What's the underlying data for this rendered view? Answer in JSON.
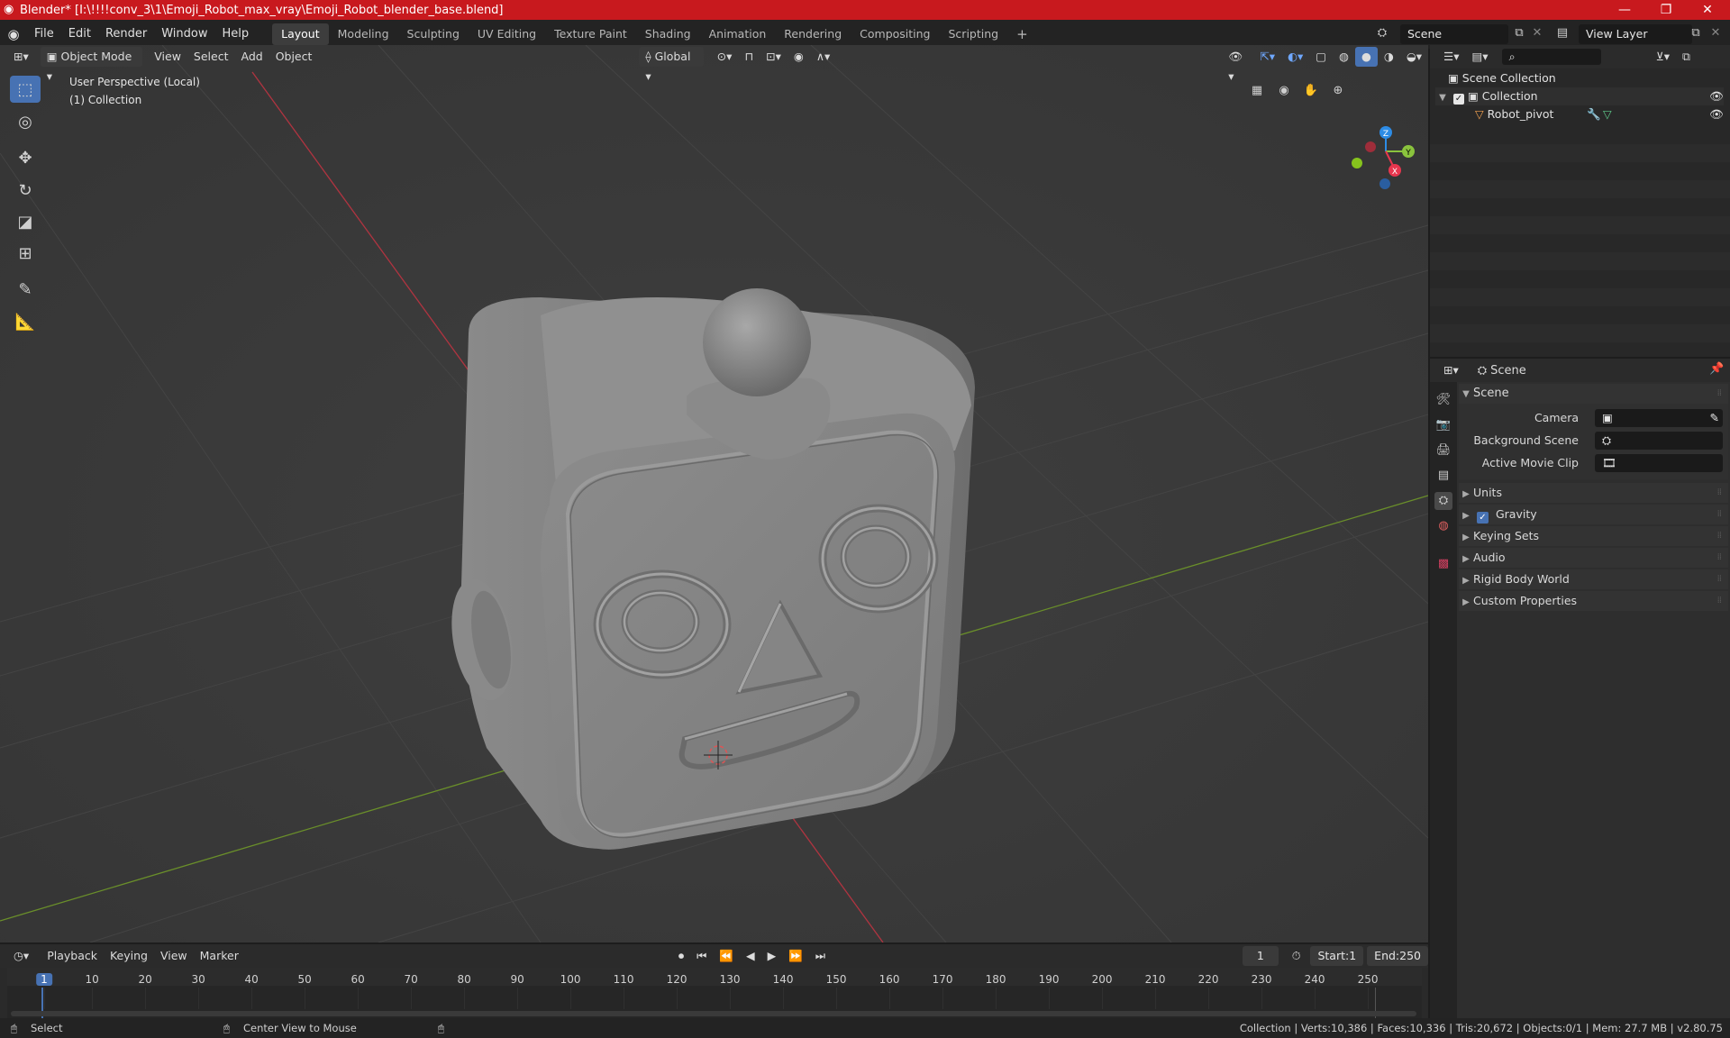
{
  "window": {
    "title": "Blender* [I:\\!!!!conv_3\\1\\Emoji_Robot_max_vray\\Emoji_Robot_blender_base.blend]",
    "minimize": "—",
    "maximize": "❐",
    "close": "✕"
  },
  "menu": [
    "File",
    "Edit",
    "Render",
    "Window",
    "Help"
  ],
  "workspaces": [
    "Layout",
    "Modeling",
    "Sculpting",
    "UV Editing",
    "Texture Paint",
    "Shading",
    "Animation",
    "Rendering",
    "Compositing",
    "Scripting"
  ],
  "workspace_add": "+",
  "scene_field": "Scene",
  "view_layer_field": "View Layer",
  "viewport": {
    "mode": "Object Mode",
    "menus": [
      "View",
      "Select",
      "Add",
      "Object"
    ],
    "transform_orientation": "Global",
    "overlay_line1": "User Perspective (Local)",
    "overlay_line2": "(1) Collection",
    "gizmo": {
      "z": "Z",
      "y": "Y",
      "x": "X"
    }
  },
  "outliner": {
    "search_placeholder": "",
    "scene_collection": "Scene Collection",
    "collection": "Collection",
    "object": "Robot_pivot"
  },
  "properties": {
    "context": "Scene",
    "panel": "Scene",
    "camera_label": "Camera",
    "background_scene_label": "Background Scene",
    "active_movie_clip_label": "Active Movie Clip",
    "sections": [
      "Units",
      "Gravity",
      "Keying Sets",
      "Audio",
      "Rigid Body World",
      "Custom Properties"
    ]
  },
  "timeline": {
    "menus": [
      "Playback",
      "Keying",
      "View",
      "Marker"
    ],
    "current_frame": "1",
    "start_label": "Start:",
    "start": "1",
    "end_label": "End:",
    "end": "250",
    "ticks": [
      "1",
      "10",
      "20",
      "30",
      "40",
      "50",
      "60",
      "70",
      "80",
      "90",
      "100",
      "110",
      "120",
      "130",
      "140",
      "150",
      "160",
      "170",
      "180",
      "190",
      "200",
      "210",
      "220",
      "230",
      "240",
      "250"
    ]
  },
  "statusbar": {
    "left1": "Select",
    "left2": "Center View to Mouse",
    "right": "Collection | Verts:10,386 | Faces:10,336 | Tris:20,672 | Objects:0/1 | Mem: 27.7 MB | v2.80.75"
  },
  "colors": {
    "titlebar": "#c8191e",
    "accent": "#4772b3",
    "axis_x": "#e8364e",
    "axis_y": "#8ac33d",
    "axis_z": "#2d8ce6"
  }
}
